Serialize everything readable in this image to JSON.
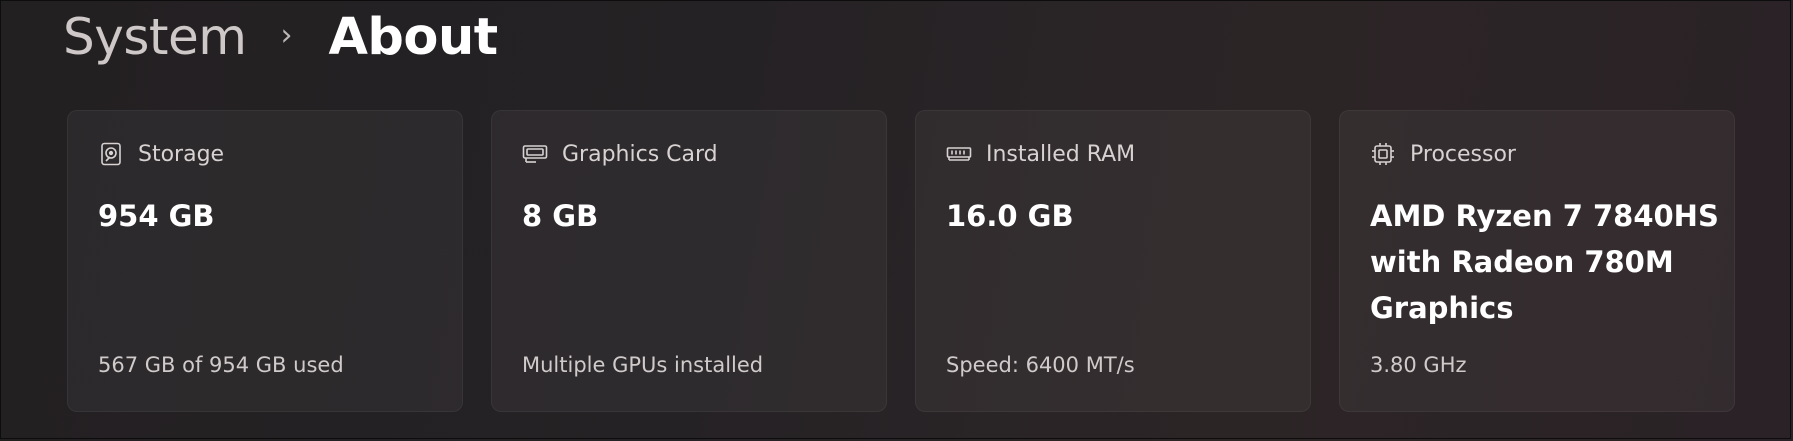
{
  "breadcrumb": {
    "parent": "System",
    "separator": "›",
    "current": "About"
  },
  "cards": [
    {
      "icon": "storage-drive-icon",
      "title": "Storage",
      "value": "954 GB",
      "detail": "567 GB of 954 GB used"
    },
    {
      "icon": "graphics-card-icon",
      "title": "Graphics Card",
      "value": "8 GB",
      "detail": "Multiple GPUs installed"
    },
    {
      "icon": "ram-icon",
      "title": "Installed RAM",
      "value": "16.0 GB",
      "detail": "Speed: 6400 MT/s"
    },
    {
      "icon": "processor-icon",
      "title": "Processor",
      "value": "AMD Ryzen 7 7840HS with Radeon 780M Graphics",
      "detail": "3.80 GHz"
    }
  ]
}
